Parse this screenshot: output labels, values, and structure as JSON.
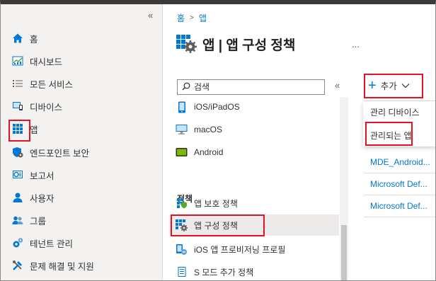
{
  "left_nav": {
    "collapse_glyph": "«",
    "items": [
      {
        "label": "홈",
        "icon": "home-icon"
      },
      {
        "label": "대시보드",
        "icon": "dashboard-icon"
      },
      {
        "label": "모든 서비스",
        "icon": "list-icon"
      },
      {
        "label": "디바이스",
        "icon": "devices-icon"
      },
      {
        "label": "앱",
        "icon": "apps-grid-icon"
      },
      {
        "label": "엔드포인트 보안",
        "icon": "shield-icon"
      },
      {
        "label": "보고서",
        "icon": "reports-icon"
      },
      {
        "label": "사용자",
        "icon": "user-icon"
      },
      {
        "label": "그룹",
        "icon": "group-icon"
      },
      {
        "label": "테넌트 관리",
        "icon": "tenant-gear-icon"
      },
      {
        "label": "문제 해결 및 지원",
        "icon": "troubleshoot-icon"
      }
    ]
  },
  "breadcrumb": {
    "home": "홈",
    "separator": ">",
    "current": "앱"
  },
  "page": {
    "title": "앱 | 앱 구성 정책",
    "more": "..."
  },
  "search": {
    "placeholder": "검색"
  },
  "middle_collapse": "«",
  "menu": {
    "platforms": [
      {
        "label": "iOS/iPadOS",
        "icon": "phone-icon"
      },
      {
        "label": "macOS",
        "icon": "monitor-icon"
      },
      {
        "label": "Android",
        "icon": "android-icon"
      }
    ],
    "section_label": "정책",
    "policies": [
      {
        "label": "앱 보호 정책",
        "icon": "app-protection-icon"
      },
      {
        "label": "앱 구성 정책",
        "icon": "app-config-icon",
        "selected": true
      },
      {
        "label": "iOS 앱 프로비저닝 프로필",
        "icon": "provisioning-icon"
      },
      {
        "label": "S 모드 추가 정책",
        "icon": "s-mode-icon"
      }
    ]
  },
  "toolbar": {
    "add_label": "추가",
    "add_chevron": "∨"
  },
  "add_dropdown": {
    "items": [
      "관리 디바이스",
      "관리되는 앱"
    ]
  },
  "results": {
    "rows": [
      "MDE_Android...",
      "Microsoft Def...",
      "Microsoft Def..."
    ]
  },
  "colors": {
    "accent": "#0078d4",
    "highlight_box": "#e81123"
  }
}
